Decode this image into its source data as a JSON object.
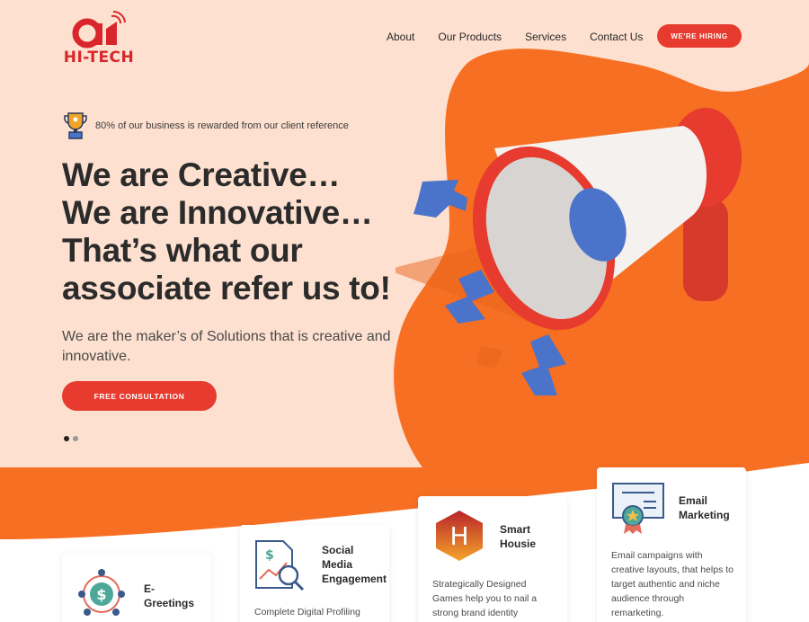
{
  "brand": {
    "logo_text": "HI-TECH"
  },
  "nav": {
    "items": [
      "About",
      "Our Products",
      "Services",
      "Contact Us"
    ],
    "hiring_label": "WE'RE HIRING"
  },
  "hero": {
    "award_text": "80% of our business is rewarded from our client reference",
    "headline": [
      "We are Creative…",
      "We are Innovative…",
      "That’s what our",
      "associate refer us to!"
    ],
    "subtext": "We are the maker’s of Solutions that is creative and innovative.",
    "cta_label": "FREE CONSULTATION",
    "slides": {
      "count": 2,
      "active": 1
    }
  },
  "cards": [
    {
      "title": "E-\nGreetings",
      "desc": "",
      "icon": "money-network-icon"
    },
    {
      "title": "Social\nMedia\nEngagement",
      "desc": "Complete Digital Profiling",
      "icon": "analytics-document-icon"
    },
    {
      "title": "Smart\nHousie",
      "desc": "Strategically Designed Games help you to nail a strong brand identity",
      "icon": "housie-h-icon"
    },
    {
      "title": "Email\nMarketing",
      "desc": "Email campaigns with creative layouts, that helps to target authentic and niche audience through remarketing.",
      "icon": "certificate-icon"
    }
  ],
  "colors": {
    "accent": "#e63b2e",
    "orange": "#f76f22",
    "background": "#fde0cf",
    "blue": "#4a73c9"
  }
}
